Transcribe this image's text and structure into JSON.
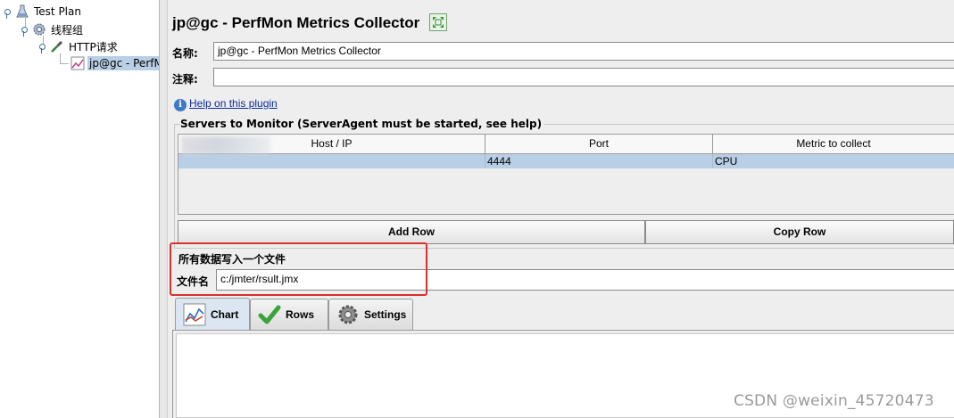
{
  "tree": {
    "items": [
      {
        "label": "Test Plan"
      },
      {
        "label": "线程组"
      },
      {
        "label": "HTTP请求"
      },
      {
        "label": "jp@gc - PerfMon Metrics Collector"
      }
    ]
  },
  "panel": {
    "title": "jp@gc - PerfMon Metrics Collector",
    "name_label": "名称:",
    "name_value": "jp@gc - PerfMon Metrics Collector",
    "comment_label": "注释:",
    "comment_value": "",
    "help_link": "Help on this plugin"
  },
  "servers": {
    "legend": "Servers to Monitor (ServerAgent must be started, see help)",
    "columns": [
      "Host / IP",
      "Port",
      "Metric to collect"
    ],
    "rows": [
      {
        "host": "",
        "port": "4444",
        "metric": "CPU"
      }
    ],
    "add_row": "Add Row",
    "copy_row": "Copy Row"
  },
  "file": {
    "legend": "所有数据写入一个文件",
    "label": "文件名",
    "value": "c:/jmter/rsult.jmx"
  },
  "tabs": [
    {
      "label": "Chart",
      "icon": "chart-icon",
      "active": true
    },
    {
      "label": "Rows",
      "icon": "checkmark-icon",
      "active": false
    },
    {
      "label": "Settings",
      "icon": "gear-icon",
      "active": false
    }
  ],
  "watermark": "CSDN @weixin_45720473",
  "colors": {
    "selection": "#b8cfe5",
    "highlight_box": "#d8322b",
    "link": "#0b2c9c"
  }
}
